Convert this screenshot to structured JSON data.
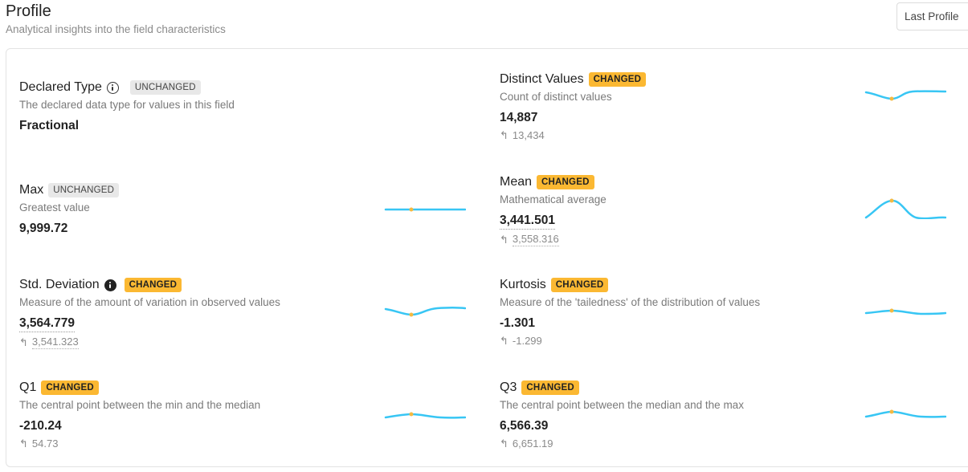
{
  "header": {
    "title": "Profile",
    "subtitle": "Analytical insights into the field characteristics",
    "last_profile_label": "Last Profile"
  },
  "colors": {
    "changed_badge": "#fbb832",
    "unchanged_badge": "#e8e8e8",
    "sparkline": "#38c6f4",
    "sparkline_marker": "#f4b942"
  },
  "metrics": {
    "declared_type": {
      "title": "Declared Type",
      "badge": "UNCHANGED",
      "description": "The declared data type for values in this field",
      "value": "Fractional",
      "icon": "info-outline-icon"
    },
    "distinct_values": {
      "title": "Distinct Values",
      "badge": "CHANGED",
      "description": "Count of distinct values",
      "value": "14,887",
      "previous": "13,434"
    },
    "max": {
      "title": "Max",
      "badge": "UNCHANGED",
      "description": "Greatest value",
      "value": "9,999.72"
    },
    "mean": {
      "title": "Mean",
      "badge": "CHANGED",
      "description": "Mathematical average",
      "value": "3,441.501",
      "previous": "3,558.316"
    },
    "std_deviation": {
      "title": "Std. Deviation",
      "badge": "CHANGED",
      "description": "Measure of the amount of variation in observed values",
      "value": "3,564.779",
      "previous": "3,541.323",
      "icon": "info-filled-icon"
    },
    "kurtosis": {
      "title": "Kurtosis",
      "badge": "CHANGED",
      "description": "Measure of the 'tailedness' of the distribution of values",
      "value": "-1.301",
      "previous": "-1.299"
    },
    "q1": {
      "title": "Q1",
      "badge": "CHANGED",
      "description": "The central point between the min and the median",
      "value": "-210.24",
      "previous": "54.73"
    },
    "q3": {
      "title": "Q3",
      "badge": "CHANGED",
      "description": "The central point between the median and the max",
      "value": "6,566.39",
      "previous": "6,651.19"
    }
  }
}
